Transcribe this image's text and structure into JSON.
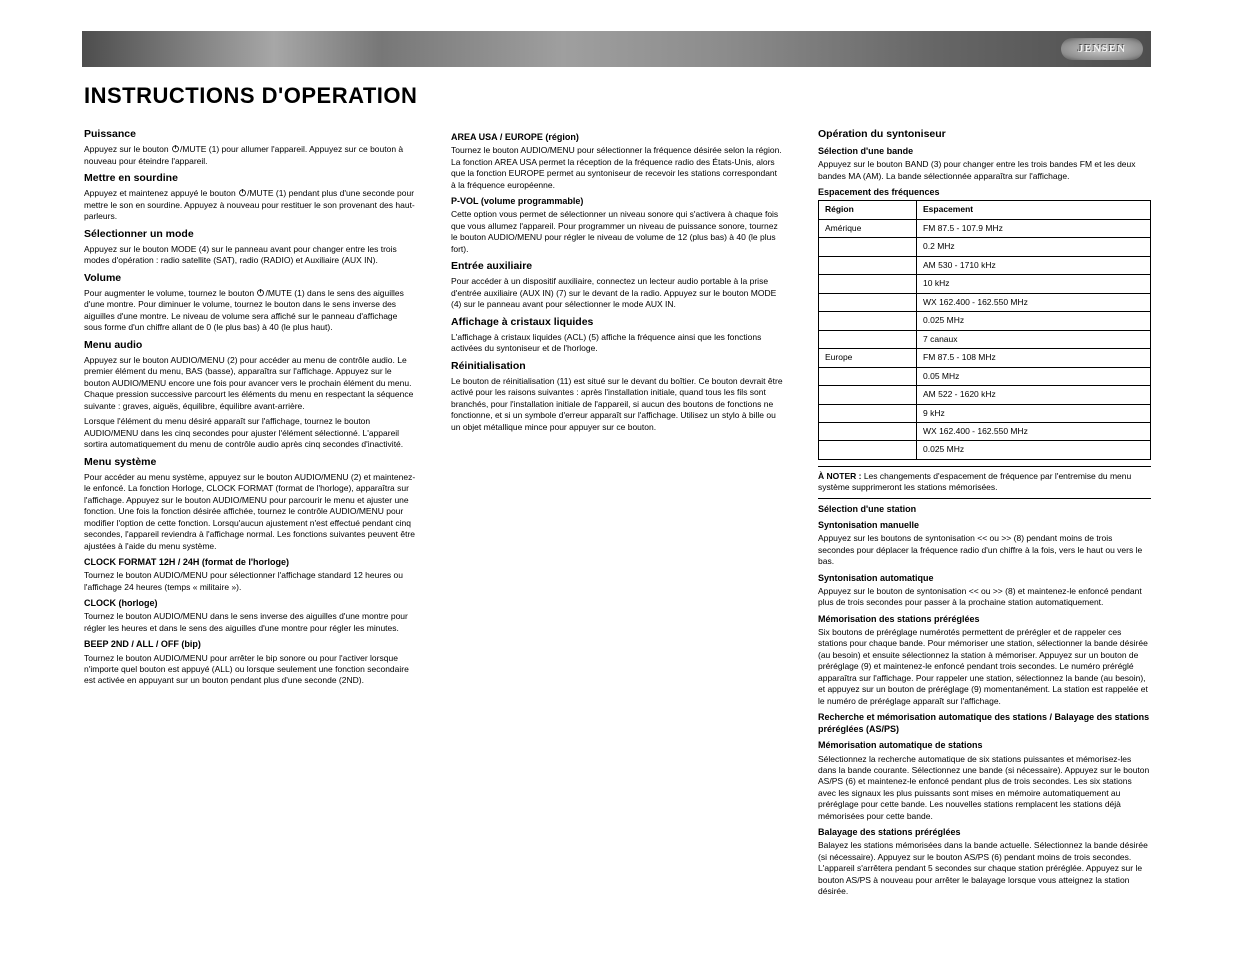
{
  "brand": "JENSEN",
  "mainTitle": "INSTRUCTIONS D'OPERATION",
  "col1": {
    "h_power": "Puissance",
    "p_power_1a": "Appuyez sur le bouton ",
    "p_power_1b": "/MUTE (1) pour allumer l'appareil. Appuyez sur ce bouton à nouveau pour éteindre l'appareil.",
    "h_mute": "Mettre en sourdine",
    "p_mute_a": "Appuyez et maintenez appuyé le bouton ",
    "p_mute_b": "/MUTE (1) pendant plus d'une seconde pour mettre le son en sourdine. Appuyez à nouveau pour restituer le son provenant des haut-parleurs.",
    "h_mode": "Sélectionner un mode",
    "p_mode": "Appuyez sur le bouton MODE (4) sur le panneau avant pour changer entre les trois modes d'opération : radio satellite (SAT), radio (RADIO) et Auxiliaire (AUX IN).",
    "h_vol": "Volume",
    "p_vol_1a": "Pour augmenter le volume, tournez le bouton ",
    "p_vol_1b": "/MUTE (1) dans le sens des aiguilles d'une montre. Pour diminuer le volume, tournez le bouton dans le sens inverse des aiguilles d'une montre. Le niveau de volume sera affiché sur le panneau d'affichage sous forme d'un chiffre allant de 0 (le plus bas) à 40 (le plus haut).",
    "h_menu": "Menu audio",
    "p_menu_1": "Appuyez sur le bouton AUDIO/MENU (2) pour accéder au menu de contrôle audio. Le premier élément du menu, BAS (basse), apparaîtra sur l'affichage. Appuyez sur le bouton AUDIO/MENU encore une fois pour avancer vers le prochain élément du menu. Chaque pression successive parcourt les éléments du menu en respectant la séquence suivante : graves, aiguës, équilibre, équilibre avant-arrière.",
    "p_menu_2": "Lorsque l'élément du menu désiré apparaît sur l'affichage, tournez le bouton AUDIO/MENU dans les cinq secondes pour ajuster l'élément sélectionné. L'appareil sortira automatiquement du menu de contrôle audio après cinq secondes d'inactivité.",
    "h_sys": "Menu système",
    "p_sys_1": "Pour accéder au menu système, appuyez sur le bouton AUDIO/MENU (2) et maintenez-le enfoncé. La fonction Horloge, CLOCK FORMAT (format de l'horloge), apparaîtra sur l'affichage. Appuyez sur le bouton AUDIO/MENU pour parcourir le menu et ajuster une fonction. Une fois la fonction désirée affichée, tournez le contrôle AUDIO/MENU pour modifier l'option de cette fonction. Lorsqu'aucun ajustement n'est effectué pendant cinq secondes, l'appareil reviendra à l'affichage normal. Les fonctions suivantes peuvent être ajustées à l'aide du menu système.",
    "h_clockfmt": "CLOCK FORMAT 12H / 24H (format de l'horloge)",
    "p_clockfmt": "Tournez le bouton AUDIO/MENU pour sélectionner l'affichage standard 12 heures ou l'affichage 24 heures (temps « militaire »).",
    "h_clock": "CLOCK (horloge)",
    "p_clock": "Tournez le bouton AUDIO/MENU dans le sens inverse des aiguilles d'une montre pour régler les heures et dans le sens des aiguilles d'une montre pour régler les minutes.",
    "h_beep": "BEEP 2ND / ALL / OFF (bip)",
    "p_beep": "Tournez le bouton AUDIO/MENU pour arrêter le bip sonore ou pour l'activer lorsque n'importe quel bouton est appuyé (ALL) ou lorsque seulement une fonction secondaire est activée en appuyant sur un bouton pendant plus d'une seconde (2ND)."
  },
  "col2": {
    "h_area": "AREA USA / EUROPE (région)",
    "p_area": "Tournez le bouton AUDIO/MENU pour sélectionner la fréquence désirée selon la région. La fonction AREA USA permet la réception de la fréquence radio des États-Unis, alors que la fonction EUROPE permet au syntoniseur de recevoir les stations correspondant à la fréquence européenne.",
    "h_pvol": "P-VOL (volume programmable)",
    "p_pvol": "Cette option vous permet de sélectionner un niveau sonore qui s'activera à chaque fois que vous allumez l'appareil. Pour programmer un niveau de puissance sonore, tournez le bouton AUDIO/MENU pour régler le niveau de volume de 12 (plus bas) à 40 (le plus fort).",
    "h_aux": "Entrée auxiliaire",
    "p_aux": "Pour accéder à un dispositif auxiliaire, connectez un lecteur audio portable à la prise d'entrée auxiliaire (AUX IN) (7) sur le devant de la radio. Appuyez sur le bouton MODE (4) sur le panneau avant pour sélectionner le mode AUX IN.",
    "h_lcd": "Affichage à cristaux liquides",
    "p_lcd": "L'affichage à cristaux liquides (ACL) (5) affiche la fréquence ainsi que les fonctions activées du syntoniseur et de l'horloge.",
    "h_reset": "Réinitialisation",
    "p_reset": "Le bouton de réinitialisation (11) est situé sur le devant du boîtier. Ce bouton devrait être activé pour les raisons suivantes : après l'installation initiale, quand tous les fils sont branchés, pour l'installation initiale de l'appareil, si aucun des boutons de fonctions ne fonctionne, et si un symbole d'erreur apparaît sur l'affichage. Utilisez un stylo à bille ou un objet métallique mince pour appuyer sur ce bouton."
  },
  "col3": {
    "h_tuner": "Opération du syntoniseur",
    "h_band": "Sélection d'une bande",
    "p_band": "Appuyez sur le bouton BAND (3) pour changer entre les trois bandes FM et les deux bandes MA (AM). La bande sélectionnée apparaîtra sur l'affichage.",
    "h_freq": "Espacement des fréquences",
    "table": {
      "headers": [
        "Région",
        "Espacement"
      ],
      "rows": [
        [
          "Amérique",
          "FM 87.5 - 107.9 MHz"
        ],
        [
          "",
          "0.2 MHz"
        ],
        [
          "",
          "AM 530 - 1710 kHz"
        ],
        [
          "",
          "10 kHz"
        ],
        [
          "",
          "WX 162.400 - 162.550 MHz"
        ],
        [
          "",
          "0.025 MHz"
        ],
        [
          "",
          "7 canaux"
        ],
        [
          "Europe",
          "FM 87.5 - 108 MHz"
        ],
        [
          "",
          "0.05 MHz"
        ],
        [
          "",
          "AM 522 - 1620 kHz"
        ],
        [
          "",
          "9 kHz"
        ],
        [
          "",
          "WX 162.400 - 162.550 MHz"
        ],
        [
          "",
          "0.025 MHz"
        ]
      ]
    },
    "note_label": "À NOTER :",
    "note_text": "Les changements d'espacement de fréquence par l'entremise du menu système supprimeront les stations mémorisées.",
    "h_select": "Sélection d'une station",
    "h_manual": "Syntonisation manuelle",
    "p_manual": "Appuyez sur les boutons de syntonisation << ou >> (8) pendant moins de trois secondes pour déplacer la fréquence radio d'un chiffre à la fois, vers le haut ou vers le bas.",
    "h_auto": "Syntonisation automatique",
    "p_auto": "Appuyez sur le bouton de syntonisation << ou >> (8) et maintenez-le enfoncé pendant plus de trois secondes pour passer à la prochaine station automatiquement.",
    "h_store": "Mémorisation des stations préréglées",
    "p_store": "Six boutons de préréglage numérotés permettent de prérégler et de rappeler ces stations pour chaque bande. Pour mémoriser une station, sélectionner la bande désirée (au besoin) et ensuite sélectionnez la station à mémoriser. Appuyez sur un bouton de préréglage (9) et maintenez-le enfoncé pendant trois secondes. Le numéro préréglé apparaîtra sur l'affichage. Pour rappeler une station, sélectionnez la bande (au besoin), et appuyez sur un bouton de préréglage (9) momentanément. La station est rappelée et le numéro de préréglage apparaît sur l'affichage.",
    "h_seek": "Recherche et mémorisation automatique des stations / Balayage des stations préréglées (AS/PS)",
    "h_autostore": "Mémorisation automatique de stations",
    "p_autostore": "Sélectionnez la recherche automatique de six stations puissantes et mémorisez-les dans la bande courante. Sélectionnez une bande (si nécessaire). Appuyez sur le bouton AS/PS (6) et maintenez-le enfoncé pendant plus de trois secondes. Les six stations avec les signaux les plus puissants sont mises en mémoire automatiquement au préréglage pour cette bande. Les nouvelles stations remplacent les stations déjà mémorisées pour cette bande.",
    "h_scan": "Balayage des stations préréglées",
    "p_scan": "Balayez les stations mémorisées dans la bande actuelle. Sélectionnez la bande désirée (si nécessaire). Appuyez sur le bouton AS/PS (6) pendant moins de trois secondes. L'appareil s'arrêtera pendant 5 secondes sur chaque station préréglée. Appuyez sur le bouton AS/PS à nouveau pour arrêter le balayage lorsque vous atteignez la station désirée."
  }
}
